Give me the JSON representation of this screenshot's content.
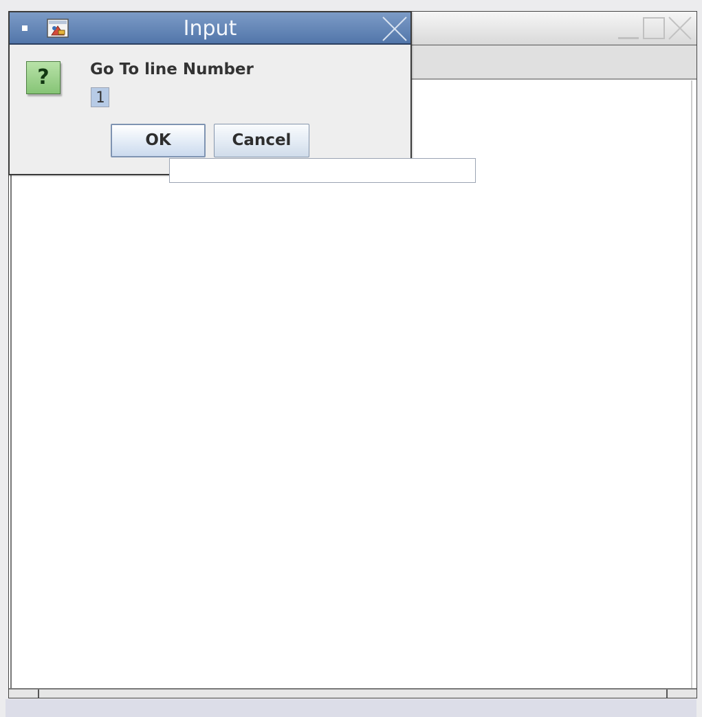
{
  "dialog": {
    "title": "Input",
    "prompt": "Go To line Number",
    "input_value": "1",
    "ok_label": "OK",
    "cancel_label": "Cancel",
    "question_glyph": "?"
  },
  "icons": {
    "dialog_menu": "window-menu-icon",
    "app": "java-app-icon",
    "question": "question-icon",
    "dialog_close": "close-icon",
    "main_minimize": "minimize-icon",
    "main_maximize": "maximize-icon",
    "main_close": "close-icon"
  },
  "colors": {
    "dialog_titlebar": "#5f81b3",
    "question_icon_bg": "#9ed48e",
    "input_selection": "#b7cbe6",
    "button_border": "#7e93b1"
  }
}
